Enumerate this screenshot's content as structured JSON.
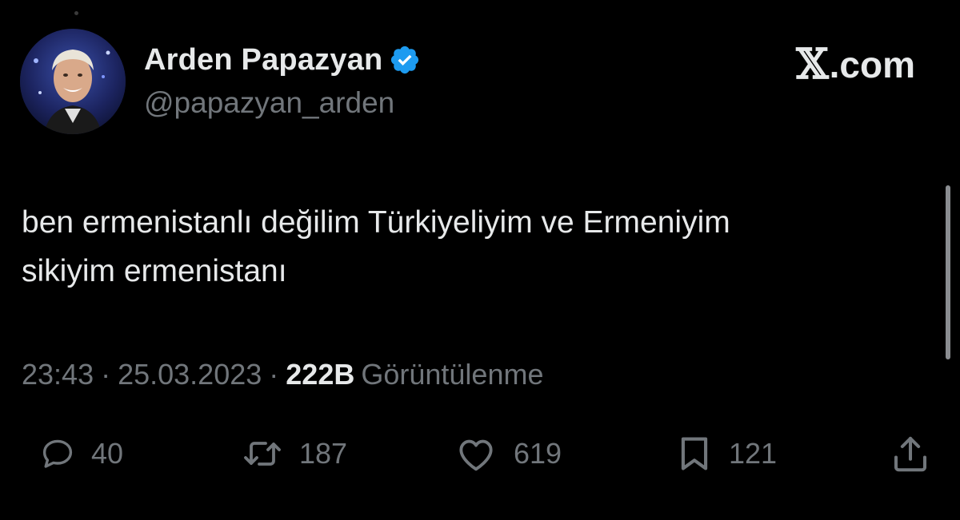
{
  "brand": {
    "x_glyph": "𝕏",
    "suffix": ".com"
  },
  "author": {
    "display_name": "Arden Papazyan",
    "handle": "@papazyan_arden",
    "verified": true,
    "verified_color": "#1d9bf0"
  },
  "tweet": {
    "text_line_1": "ben ermenistanlı değilim Türkiyeliyim ve Ermeniyim",
    "text_line_2": "sikiyim ermenistanı",
    "time": "23:43",
    "separator": "·",
    "date": "25.03.2023",
    "views_count": "222B",
    "views_label": "Görüntülenme"
  },
  "actions": {
    "replies": "40",
    "reposts": "187",
    "likes": "619",
    "bookmarks": "121"
  },
  "icons": {
    "reply": "reply-icon",
    "repost": "repost-icon",
    "like": "heart-icon",
    "bookmark": "bookmark-icon",
    "share": "share-icon"
  },
  "colors": {
    "background": "#000000",
    "text_primary": "#e7e9ea",
    "text_secondary": "#71767b"
  }
}
